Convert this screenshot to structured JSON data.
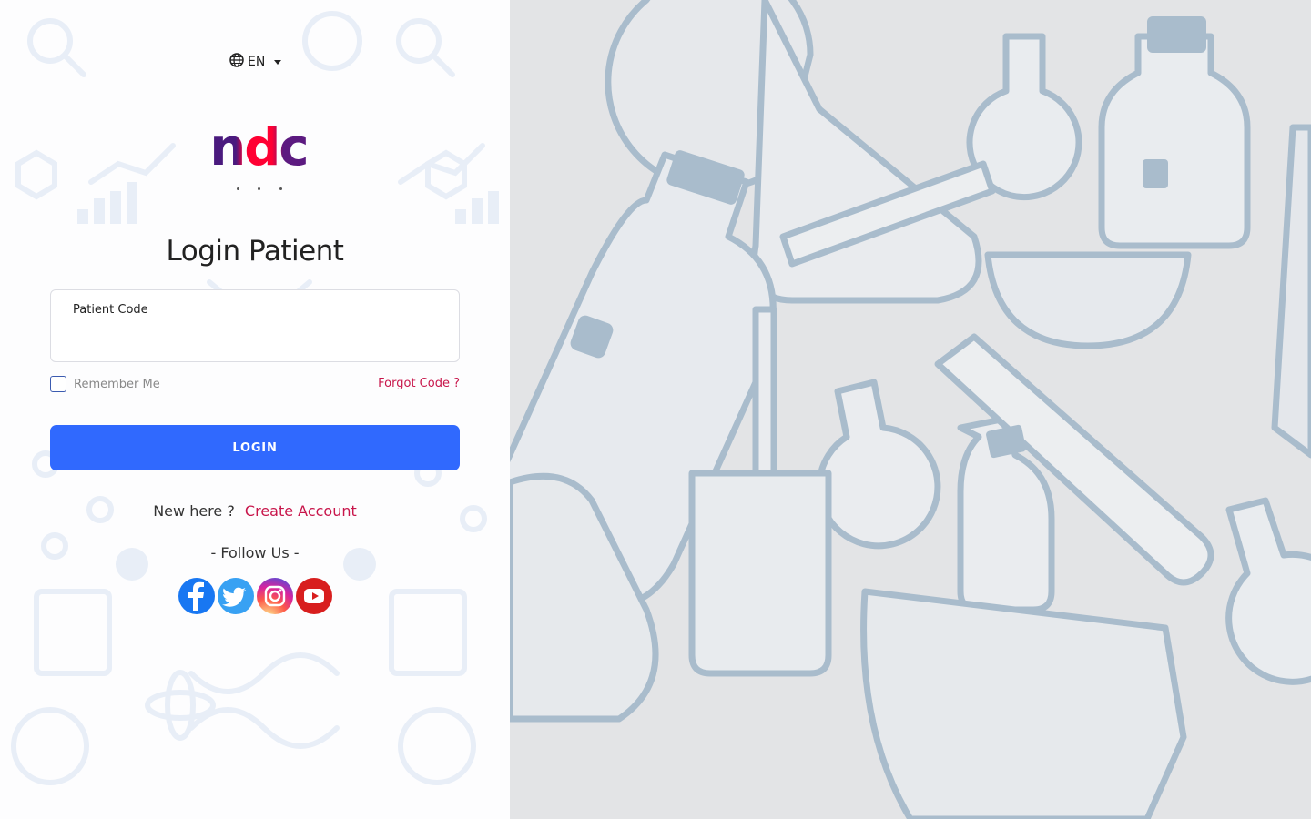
{
  "language": {
    "code": "EN",
    "icon": "globe-icon"
  },
  "logo": {
    "text": "ndc"
  },
  "title": "Login Patient",
  "form": {
    "patient_code_label": "Patient Code",
    "patient_code_value": "",
    "remember_label": "Remember Me",
    "remember_checked": false,
    "forgot_label": "Forgot Code ?",
    "login_label": "LOGIN"
  },
  "signup": {
    "prompt": "New here ?",
    "link": "Create Account"
  },
  "follow": {
    "label": "- Follow Us -",
    "networks": [
      {
        "name": "facebook",
        "icon": "facebook-icon",
        "color": "#1877f2"
      },
      {
        "name": "twitter",
        "icon": "twitter-icon",
        "color": "#38a1f3"
      },
      {
        "name": "instagram",
        "icon": "instagram-icon",
        "color": "#d6249f"
      },
      {
        "name": "youtube",
        "icon": "youtube-icon",
        "color": "#d81e1e"
      }
    ]
  },
  "colors": {
    "primary": "#3069fe",
    "accent": "#c8164b",
    "panel_bg": "#e3e4e6",
    "glass": "#a9bccc"
  }
}
